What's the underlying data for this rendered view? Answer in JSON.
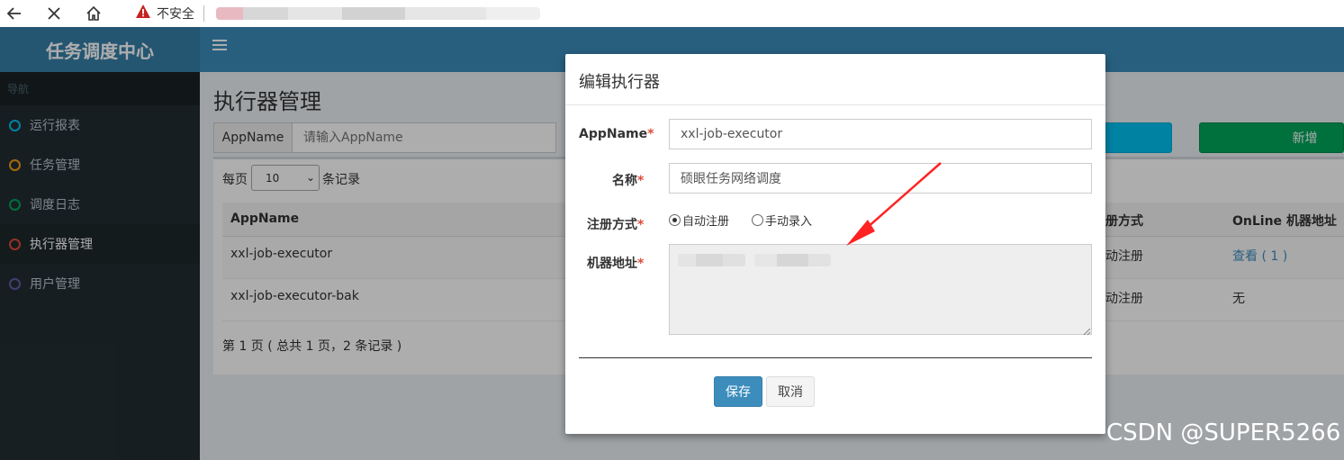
{
  "browser": {
    "insecure_label": "不安全",
    "icons": [
      "back-arrow-icon",
      "close-icon",
      "home-icon",
      "warning-icon"
    ]
  },
  "app": {
    "title": "任务调度中心"
  },
  "sidebar": {
    "header": "导航",
    "items": [
      {
        "label": "运行报表",
        "dot_color": "#00c0ef",
        "active": false
      },
      {
        "label": "任务管理",
        "dot_color": "#f39c12",
        "active": false
      },
      {
        "label": "调度日志",
        "dot_color": "#00a65a",
        "active": false
      },
      {
        "label": "执行器管理",
        "dot_color": "#dd4b39",
        "active": true
      },
      {
        "label": "用户管理",
        "dot_color": "#605ca8",
        "active": false
      }
    ]
  },
  "content": {
    "page_title": "执行器管理",
    "search": {
      "addon_label": "AppName",
      "placeholder": "请输入AppName"
    },
    "add_button_label": "新增",
    "per_page": {
      "prefix": "每页",
      "value": "10",
      "suffix": "条记录"
    },
    "table": {
      "columns": [
        "AppName",
        "注册方式",
        "OnLine 机器地址"
      ],
      "visible_header_text": {
        "col_appname": "AppName",
        "col_register": "册方式",
        "col_online": "OnLine 机器地址"
      },
      "rows": [
        {
          "appname": "xxl-job-executor",
          "register_visible": "动注册",
          "online": "查看 ( 1 )"
        },
        {
          "appname": "xxl-job-executor-bak",
          "register_visible": "动注册",
          "online": "无"
        }
      ]
    },
    "pager_text": "第 1 页 ( 总共 1 页，2 条记录 )"
  },
  "modal": {
    "title": "编辑执行器",
    "fields": {
      "appname": {
        "label": "AppName",
        "value": "xxl-job-executor"
      },
      "name": {
        "label": "名称",
        "value": "硕眼任务网络调度"
      },
      "register_type": {
        "label": "注册方式",
        "options": [
          "自动注册",
          "手动录入"
        ],
        "selected": "自动注册"
      },
      "address": {
        "label": "机器地址"
      }
    },
    "required_mark": "*",
    "save_label": "保存",
    "cancel_label": "取消"
  },
  "colors": {
    "brand_blue": "#3c8dbc",
    "logo_blue": "#367fa9",
    "sidebar_dark": "#222d32",
    "add_green": "#00a65a",
    "search_cyan": "#00c0ef",
    "required_red": "#dd4b39",
    "arrow_red": "#ff2222"
  },
  "watermark": "CSDN @SUPER5266"
}
